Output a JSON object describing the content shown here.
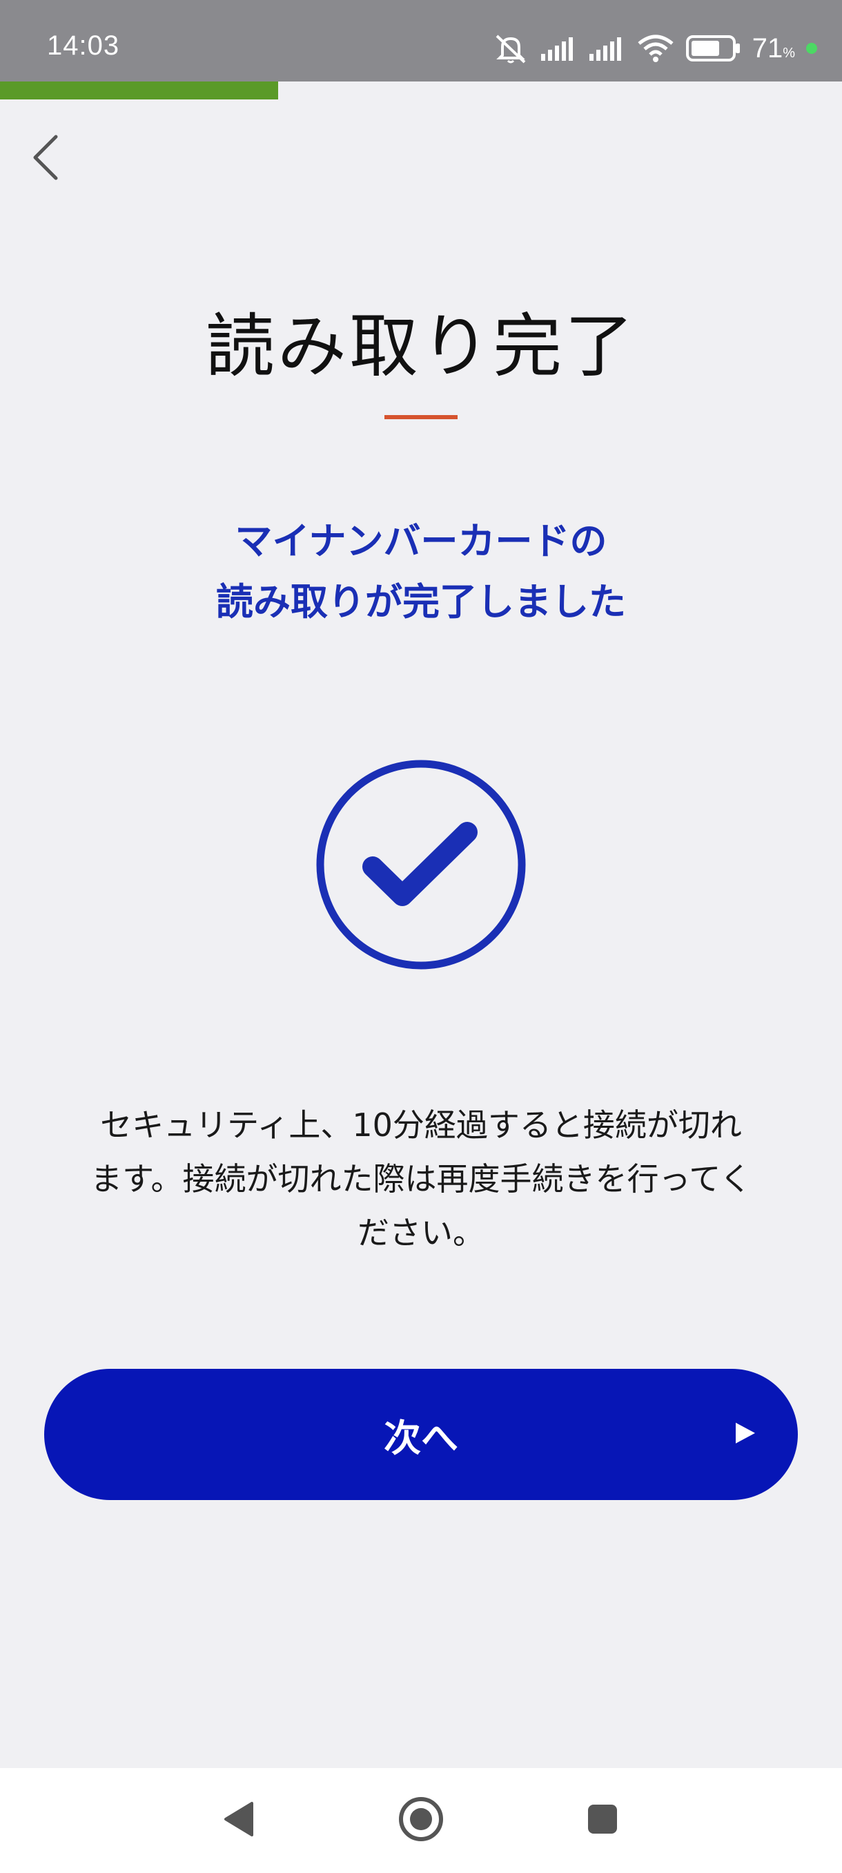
{
  "status_bar": {
    "time": "14:03",
    "battery_percent": "71",
    "battery_unit": "%",
    "icons": [
      "mute-icon",
      "signal-icon",
      "signal-icon",
      "wifi-icon",
      "battery-icon"
    ]
  },
  "progress": {
    "fraction": 0.33,
    "color": "#5a9a28"
  },
  "header": {
    "back_icon": "chevron-left-icon"
  },
  "main": {
    "title": "読み取り完了",
    "subtitle_line1": "マイナンバーカードの",
    "subtitle_line2": "読み取りが完了しました",
    "success_icon": "check-circle-icon",
    "notice_line1": "セキュリティ上、10分経過すると接続が切れ",
    "notice_line2": "ます。接続が切れた際は再度手続きを行ってく",
    "notice_line3": "ださい。"
  },
  "actions": {
    "next_label": "次へ",
    "next_icon": "play-arrow-icon"
  },
  "nav_bar": {
    "back": "triangle-back-icon",
    "home": "circle-home-icon",
    "recents": "square-recents-icon"
  },
  "colors": {
    "accent_blue": "#0716b6",
    "title_blue": "#1a2fb5",
    "underline_orange": "#d6532e",
    "background": "#f0f0f3"
  }
}
